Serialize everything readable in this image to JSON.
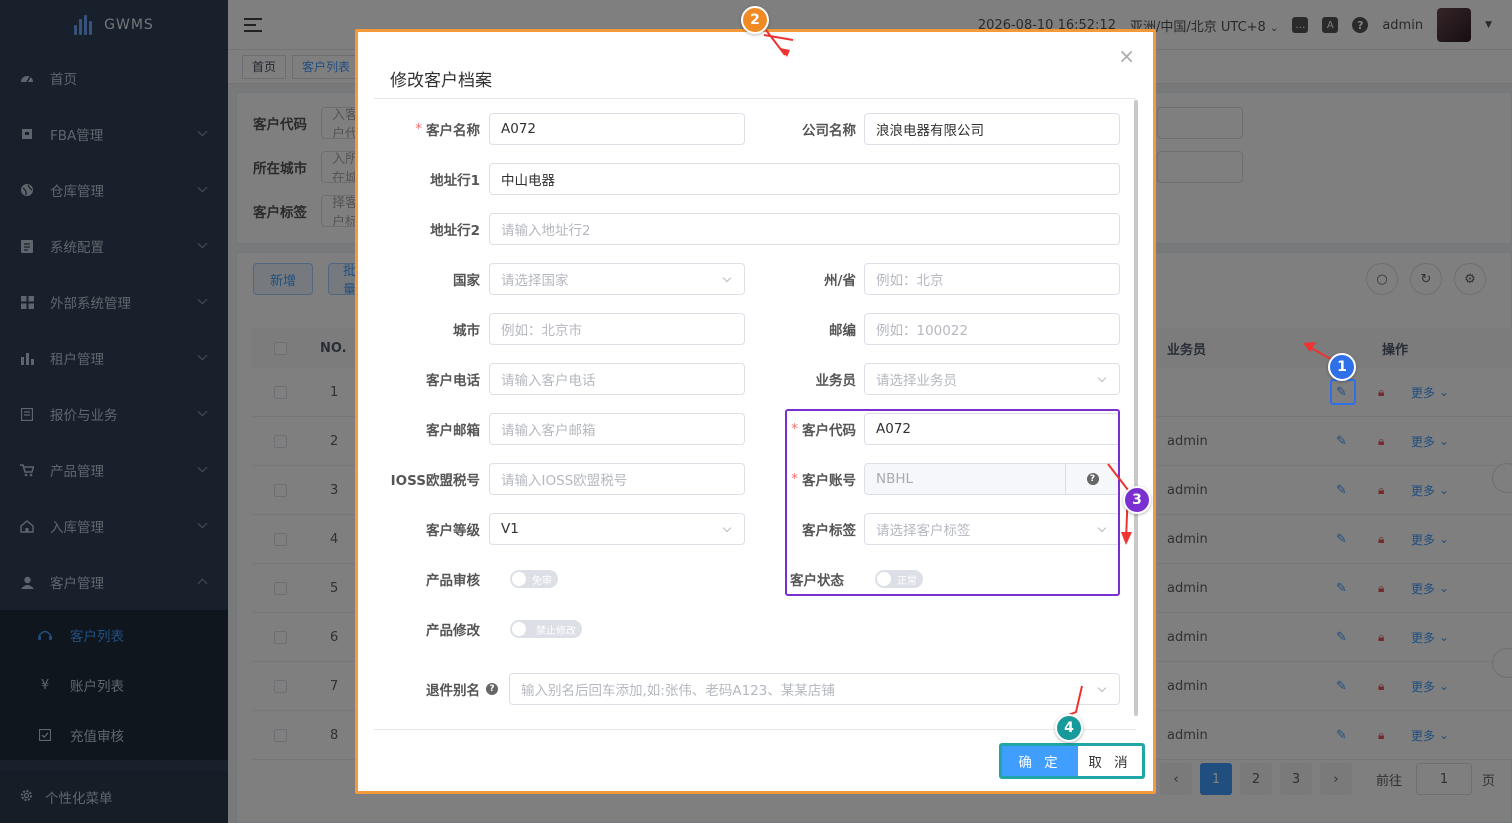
{
  "app": {
    "name": "GWMS"
  },
  "sidebar": {
    "items": [
      {
        "label": "首页",
        "icon": "dashboard-icon"
      },
      {
        "label": "FBA管理",
        "icon": "box-icon"
      },
      {
        "label": "仓库管理",
        "icon": "globe-icon"
      },
      {
        "label": "系统配置",
        "icon": "list-icon"
      },
      {
        "label": "外部系统管理",
        "icon": "grid-icon"
      },
      {
        "label": "租户管理",
        "icon": "bar-chart-icon"
      },
      {
        "label": "报价与业务",
        "icon": "document-icon"
      },
      {
        "label": "产品管理",
        "icon": "cart-icon"
      },
      {
        "label": "入库管理",
        "icon": "home-icon"
      },
      {
        "label": "客户管理",
        "icon": "user-icon"
      }
    ],
    "subitems": [
      {
        "label": "客户列表",
        "icon": "customer-icon",
        "active": true
      },
      {
        "label": "账户列表",
        "icon": "yen-icon",
        "active": false
      },
      {
        "label": "充值审核",
        "icon": "checkbox-icon",
        "active": false
      }
    ],
    "bottom": "个性化菜单"
  },
  "topbar": {
    "datetime": "2026-08-10 16:52:12",
    "timezone": "亚洲/中国/北京 UTC+8",
    "user": "admin"
  },
  "tags": [
    "首页",
    "客户列表"
  ],
  "search": {
    "labels": [
      "客户代码",
      "所在城市",
      "客户标签"
    ],
    "placeholders": [
      "请输入客户代码",
      "请输入所在城市",
      "请选择客户标签"
    ]
  },
  "actions": {
    "add": "新增",
    "batch": "批量"
  },
  "table": {
    "headers": {
      "no": "NO.",
      "salesman": "业务员",
      "ops": "操作"
    },
    "rows": [
      {
        "no": "1",
        "salesman": ""
      },
      {
        "no": "2",
        "salesman": "admin"
      },
      {
        "no": "3",
        "salesman": "admin"
      },
      {
        "no": "4",
        "salesman": "admin"
      },
      {
        "no": "5",
        "salesman": "admin"
      },
      {
        "no": "6",
        "salesman": "admin"
      },
      {
        "no": "7",
        "salesman": "admin"
      },
      {
        "no": "8",
        "salesman": "admin"
      }
    ],
    "more": "更多"
  },
  "pagination": {
    "pages": [
      "1",
      "2",
      "3"
    ],
    "goto": "前往",
    "goto_value": "1",
    "page_suffix": "页"
  },
  "dialog": {
    "title": "修改客户档案",
    "fields": {
      "customer_name": {
        "label": "客户名称",
        "value": "A072"
      },
      "company_name": {
        "label": "公司名称",
        "value": "浪浪电器有限公司"
      },
      "address1": {
        "label": "地址行1",
        "value": "中山电器"
      },
      "address2": {
        "label": "地址行2",
        "placeholder": "请输入地址行2"
      },
      "country": {
        "label": "国家",
        "placeholder": "请选择国家"
      },
      "state": {
        "label": "州/省",
        "placeholder": "例如：北京"
      },
      "city": {
        "label": "城市",
        "placeholder": "例如：北京市"
      },
      "zip": {
        "label": "邮编",
        "placeholder": "例如：100022"
      },
      "phone": {
        "label": "客户电话",
        "placeholder": "请输入客户电话"
      },
      "salesman": {
        "label": "业务员",
        "placeholder": "请选择业务员"
      },
      "email": {
        "label": "客户邮箱",
        "placeholder": "请输入客户邮箱"
      },
      "customer_code": {
        "label": "客户代码",
        "value": "A072"
      },
      "ioss": {
        "label": "IOSS欧盟税号",
        "placeholder": "请输入IOSS欧盟税号"
      },
      "account": {
        "label": "客户账号",
        "value": "NBHL"
      },
      "level": {
        "label": "客户等级",
        "value": "V1"
      },
      "customer_tag": {
        "label": "客户标签",
        "placeholder": "请选择客户标签"
      },
      "product_review": {
        "label": "产品审核",
        "switch_text": "免审"
      },
      "customer_status": {
        "label": "客户状态",
        "switch_text": "正常"
      },
      "product_edit": {
        "label": "产品修改",
        "switch_text": "禁止修改"
      },
      "return_alias": {
        "label": "退件别名",
        "placeholder": "输入别名后回车添加,如:张伟、老码A123、某某店铺"
      }
    },
    "buttons": {
      "confirm": "确 定",
      "cancel": "取 消"
    }
  },
  "annotations": {
    "a1": "1",
    "a2": "2",
    "a3": "3",
    "a4": "4",
    "colors": {
      "a1": "#2f6fe8",
      "a2": "#f08a24",
      "a3": "#7a2fd0",
      "a4": "#179a9a"
    }
  }
}
